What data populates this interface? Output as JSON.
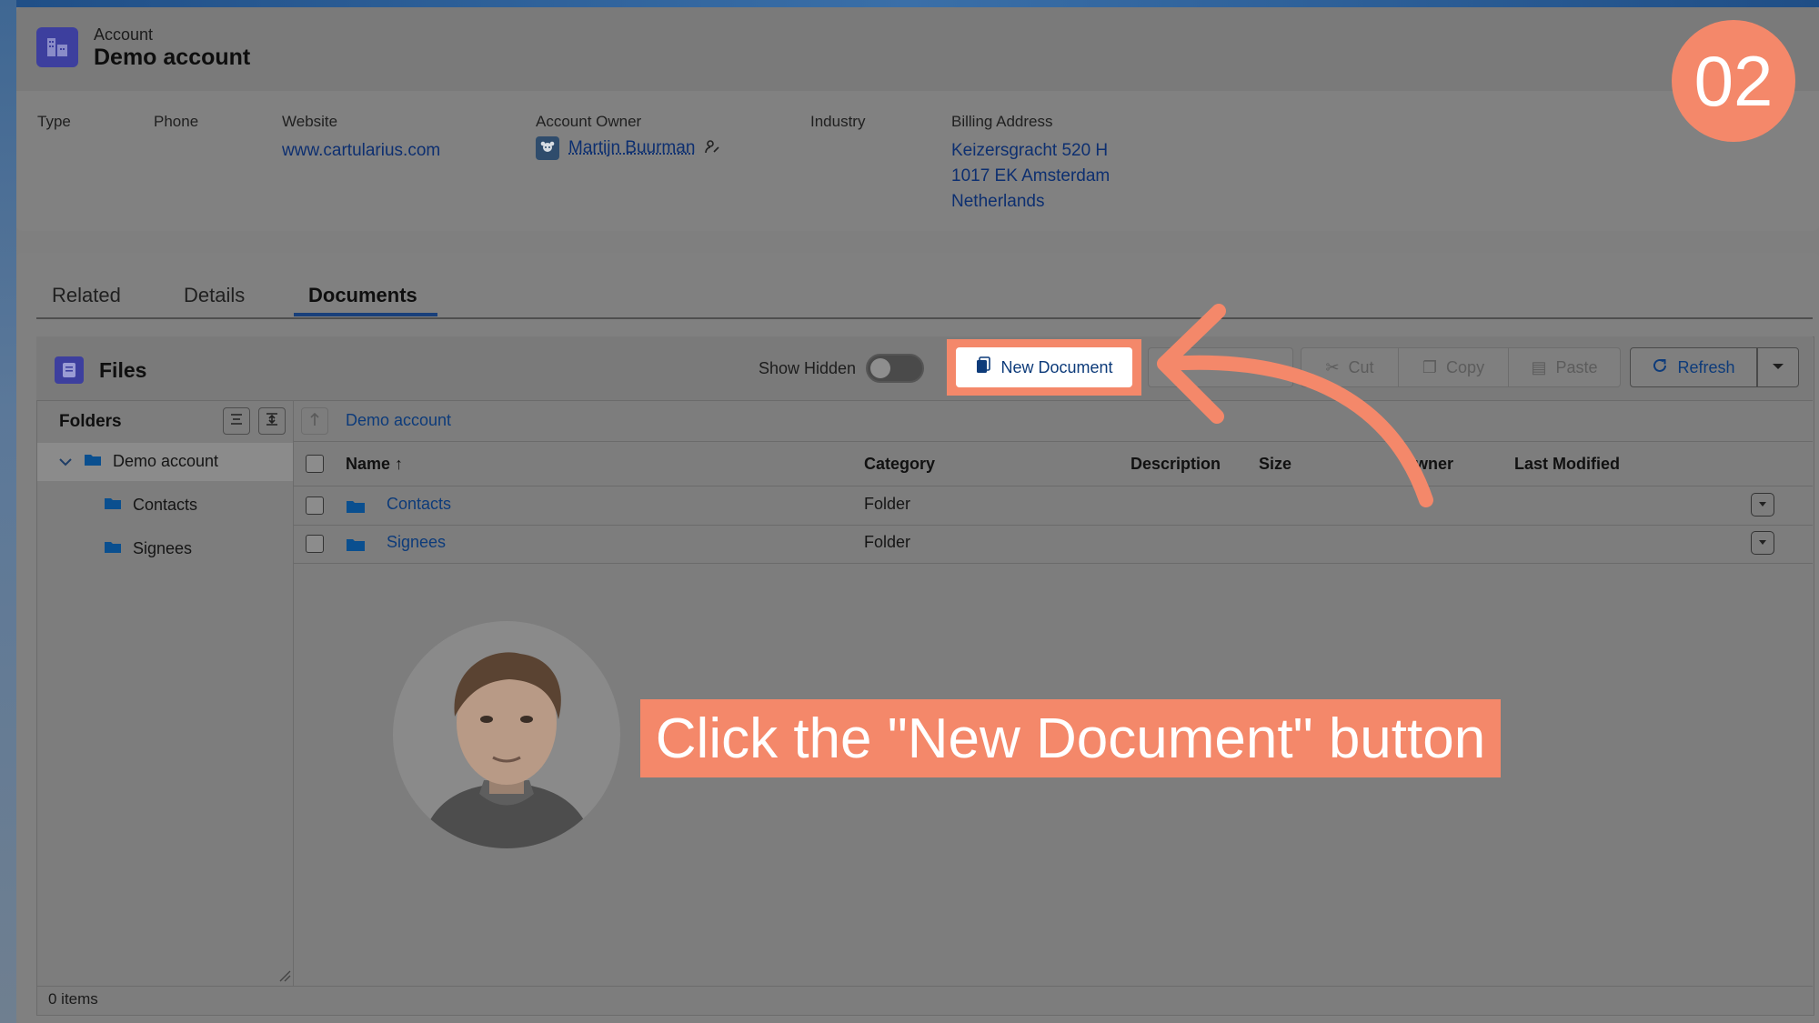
{
  "header": {
    "object_type": "Account",
    "title": "Demo account"
  },
  "fields": {
    "type_label": "Type",
    "phone_label": "Phone",
    "website_label": "Website",
    "website_value": "www.cartularius.com",
    "owner_label": "Account Owner",
    "owner_value": "Martijn Buurman",
    "industry_label": "Industry",
    "billing_label": "Billing Address",
    "billing_line1": "Keizersgracht 520 H",
    "billing_line2": "1017 EK Amsterdam",
    "billing_line3": "Netherlands"
  },
  "step_badge": "02",
  "tabs": [
    {
      "label": "Related"
    },
    {
      "label": "Details"
    },
    {
      "label": "Documents",
      "active": true
    }
  ],
  "files": {
    "title": "Files",
    "show_hidden_label": "Show Hidden",
    "show_hidden_on": false,
    "new_document_label": "New Document",
    "cut_label": "Cut",
    "copy_label": "Copy",
    "paste_label": "Paste",
    "refresh_label": "Refresh"
  },
  "folders": {
    "title": "Folders",
    "tree": [
      {
        "label": "Demo account",
        "expanded": true,
        "selected": true
      },
      {
        "label": "Contacts"
      },
      {
        "label": "Signees"
      }
    ]
  },
  "breadcrumb": "Demo account",
  "table": {
    "columns": [
      "Name ↑",
      "Category",
      "Description",
      "Size",
      "wner",
      "Last Modified"
    ],
    "rows": [
      {
        "name": "Contacts",
        "category": "Folder"
      },
      {
        "name": "Signees",
        "category": "Folder"
      }
    ]
  },
  "footer": {
    "items_count": "0 items"
  },
  "callout": {
    "text": "Click the \"New Document\" button"
  },
  "colors": {
    "accent": "#f4886a",
    "link": "#0d3b7a",
    "object_icon": "#3d3f9e"
  },
  "icons": [
    "account-icon",
    "owner-avatar-icon",
    "change-owner-icon",
    "files-icon",
    "new-document-icon",
    "cut-icon",
    "copy-icon",
    "paste-icon",
    "refresh-icon",
    "chevron-down-icon",
    "collapse-all-icon",
    "expand-all-icon",
    "folder-icon",
    "up-arrow-icon",
    "row-menu-icon"
  ]
}
